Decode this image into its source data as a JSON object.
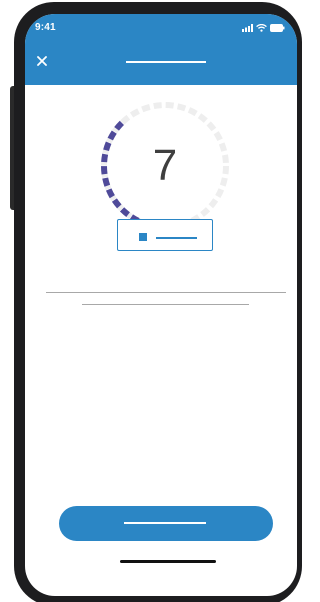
{
  "status_bar": {
    "time": "9:41",
    "icons": [
      "signal-icon",
      "wifi-icon",
      "battery-icon"
    ]
  },
  "header": {
    "close_icon": "close-icon",
    "title": ""
  },
  "score": {
    "value": "7",
    "progress_fraction": 0.32,
    "progress_color": "#4f4a99",
    "track_color": "#eeeeee"
  },
  "legend": {
    "label": ""
  },
  "primary_button": {
    "label": ""
  },
  "colors": {
    "accent": "#2b86c5"
  }
}
